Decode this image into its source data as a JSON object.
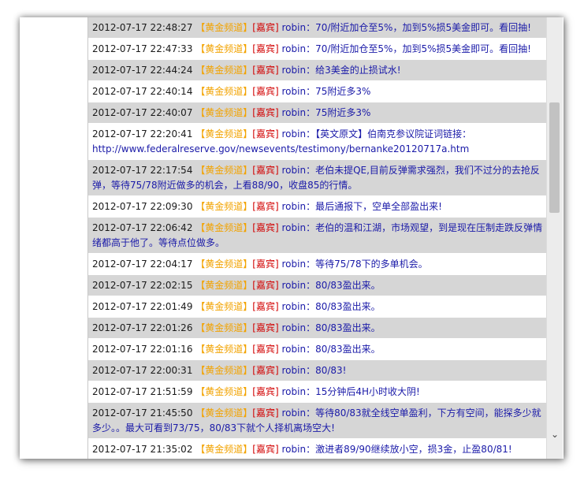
{
  "messages": [
    {
      "time": "2012-07-17 22:48:27",
      "channel": "【黄金频道】",
      "role": "[嘉宾]",
      "name": "robin",
      "sep": "：",
      "text": "70/附近加仓至5%，加到5%损5美金即可。看回抽!"
    },
    {
      "time": "2012-07-17 22:47:33",
      "channel": "【黄金频道】",
      "role": "[嘉宾]",
      "name": "robin",
      "sep": "：",
      "text": "70/附近加仓至5%，加到5%损5美金即可。看回抽!"
    },
    {
      "time": "2012-07-17 22:44:24",
      "channel": "【黄金频道】",
      "role": "[嘉宾]",
      "name": "robin",
      "sep": "：",
      "text": "给3美金的止损试水!"
    },
    {
      "time": "2012-07-17 22:40:14",
      "channel": "【黄金频道】",
      "role": "[嘉宾]",
      "name": "robin",
      "sep": "：",
      "text": "75附近多3%"
    },
    {
      "time": "2012-07-17 22:40:07",
      "channel": "【黄金频道】",
      "role": "[嘉宾]",
      "name": "robin",
      "sep": "：",
      "text": "75附近多3%"
    },
    {
      "time": "2012-07-17 22:20:41",
      "channel": "【黄金频道】",
      "role": "[嘉宾]",
      "name": "robin",
      "sep": "：",
      "text": "【英文原文】伯南克参议院证词链接：",
      "link": "http://www.federalreserve.gov/newsevents/testimony/bernanke20120717a.htm"
    },
    {
      "time": "2012-07-17 22:17:54",
      "channel": "【黄金频道】",
      "role": "[嘉宾]",
      "name": "robin",
      "sep": "：",
      "text": "老伯未提QE,目前反弹需求强烈，我们不过分的去抢反弹，等待75/78附近做多的机会，上看88/90，收盘85的行情。"
    },
    {
      "time": "2012-07-17 22:09:30",
      "channel": "【黄金频道】",
      "role": "[嘉宾]",
      "name": "robin",
      "sep": "：",
      "text": "最后通报下，空单全部盈出来!"
    },
    {
      "time": "2012-07-17 22:06:42",
      "channel": "【黄金频道】",
      "role": "[嘉宾]",
      "name": "robin",
      "sep": "：",
      "text": "老伯的温和江湖，市场观望，到是现在压制走跌反弹情绪都高于他了。等待点位做多。"
    },
    {
      "time": "2012-07-17 22:04:17",
      "channel": "【黄金频道】",
      "role": "[嘉宾]",
      "name": "robin",
      "sep": "：",
      "text": "等待75/78下的多单机会。"
    },
    {
      "time": "2012-07-17 22:02:15",
      "channel": "【黄金频道】",
      "role": "[嘉宾]",
      "name": "robin",
      "sep": "：",
      "text": "80/83盈出来。"
    },
    {
      "time": "2012-07-17 22:01:49",
      "channel": "【黄金频道】",
      "role": "[嘉宾]",
      "name": "robin",
      "sep": "：",
      "text": "80/83盈出来。"
    },
    {
      "time": "2012-07-17 22:01:26",
      "channel": "【黄金频道】",
      "role": "[嘉宾]",
      "name": "robin",
      "sep": "：",
      "text": "80/83盈出来。"
    },
    {
      "time": "2012-07-17 22:01:16",
      "channel": "【黄金频道】",
      "role": "[嘉宾]",
      "name": "robin",
      "sep": "：",
      "text": "80/83盈出来。"
    },
    {
      "time": "2012-07-17 22:00:31",
      "channel": "【黄金频道】",
      "role": "[嘉宾]",
      "name": "robin",
      "sep": "：",
      "text": "80/83!"
    },
    {
      "time": "2012-07-17 21:51:59",
      "channel": "【黄金频道】",
      "role": "[嘉宾]",
      "name": "robin",
      "sep": "：",
      "text": "15分钟后4H小时收大阴!"
    },
    {
      "time": "2012-07-17 21:45:50",
      "channel": "【黄金频道】",
      "role": "[嘉宾]",
      "name": "robin",
      "sep": "：",
      "text": "等待80/83就全线空单盈利，下方有空间，能探多少就多少。。最大可看到73/75，80/83下就个人择机离场空大!"
    },
    {
      "time": "2012-07-17 21:35:02",
      "channel": "【黄金频道】",
      "role": "[嘉宾]",
      "name": "robin",
      "sep": "：",
      "text": "激进者89/90继续放小空，损3金，止盈80/81!"
    }
  ],
  "colors": {
    "channel": "#f2a300",
    "role": "#d20000",
    "name": "#1a1aa8",
    "row_gray": "#d6d6d6",
    "row_white": "#ffffff"
  },
  "scrollbar": {
    "icon": "chevron-down-icon"
  }
}
